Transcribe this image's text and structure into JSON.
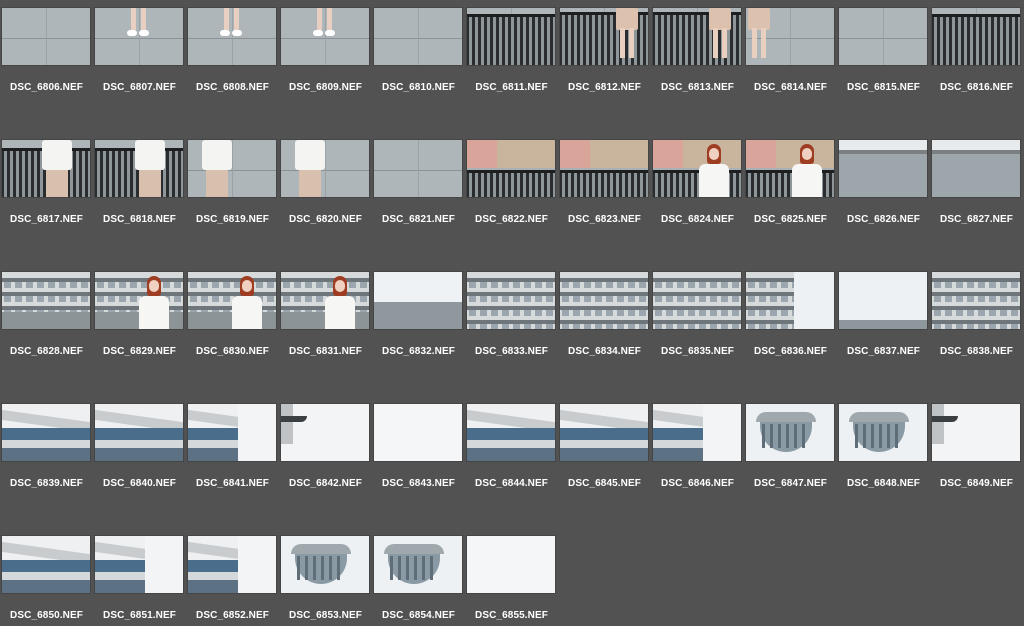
{
  "window": {
    "title": ""
  },
  "colors": {
    "background": "#525252",
    "label": "#ffffff"
  },
  "grid": {
    "columns": 11,
    "files": [
      {
        "name": "DSC_6806.NEF",
        "scene": "pavement"
      },
      {
        "name": "DSC_6807.NEF",
        "scene": "feet"
      },
      {
        "name": "DSC_6808.NEF",
        "scene": "feet"
      },
      {
        "name": "DSC_6809.NEF",
        "scene": "feet"
      },
      {
        "name": "DSC_6810.NEF",
        "scene": "pavement"
      },
      {
        "name": "DSC_6811.NEF",
        "scene": "railing"
      },
      {
        "name": "DSC_6812.NEF",
        "scene": "railing-legs"
      },
      {
        "name": "DSC_6813.NEF",
        "scene": "railing-legs"
      },
      {
        "name": "DSC_6814.NEF",
        "scene": "legs"
      },
      {
        "name": "DSC_6815.NEF",
        "scene": "pavement"
      },
      {
        "name": "DSC_6816.NEF",
        "scene": "railing"
      },
      {
        "name": "DSC_6817.NEF",
        "scene": "railing-torso"
      },
      {
        "name": "DSC_6818.NEF",
        "scene": "railing-torso"
      },
      {
        "name": "DSC_6819.NEF",
        "scene": "torso"
      },
      {
        "name": "DSC_6820.NEF",
        "scene": "torso"
      },
      {
        "name": "DSC_6821.NEF",
        "scene": "pavement"
      },
      {
        "name": "DSC_6822.NEF",
        "scene": "embankment"
      },
      {
        "name": "DSC_6823.NEF",
        "scene": "embankment"
      },
      {
        "name": "DSC_6824.NEF",
        "scene": "embankment-woman"
      },
      {
        "name": "DSC_6825.NEF",
        "scene": "embankment-woman"
      },
      {
        "name": "DSC_6826.NEF",
        "scene": "promenade"
      },
      {
        "name": "DSC_6827.NEF",
        "scene": "promenade"
      },
      {
        "name": "DSC_6828.NEF",
        "scene": "building"
      },
      {
        "name": "DSC_6829.NEF",
        "scene": "building-woman"
      },
      {
        "name": "DSC_6830.NEF",
        "scene": "building-woman"
      },
      {
        "name": "DSC_6831.NEF",
        "scene": "building-woman"
      },
      {
        "name": "DSC_6832.NEF",
        "scene": "promenade-sky"
      },
      {
        "name": "DSC_6833.NEF",
        "scene": "facade"
      },
      {
        "name": "DSC_6834.NEF",
        "scene": "facade"
      },
      {
        "name": "DSC_6835.NEF",
        "scene": "facade"
      },
      {
        "name": "DSC_6836.NEF",
        "scene": "facade-sky"
      },
      {
        "name": "DSC_6837.NEF",
        "scene": "sky-low"
      },
      {
        "name": "DSC_6838.NEF",
        "scene": "facade"
      },
      {
        "name": "DSC_6839.NEF",
        "scene": "balcony"
      },
      {
        "name": "DSC_6840.NEF",
        "scene": "balcony"
      },
      {
        "name": "DSC_6841.NEF",
        "scene": "balcony-sky"
      },
      {
        "name": "DSC_6842.NEF",
        "scene": "sky-edge"
      },
      {
        "name": "DSC_6843.NEF",
        "scene": "sky"
      },
      {
        "name": "DSC_6844.NEF",
        "scene": "balcony"
      },
      {
        "name": "DSC_6845.NEF",
        "scene": "balcony"
      },
      {
        "name": "DSC_6846.NEF",
        "scene": "balcony-sky"
      },
      {
        "name": "DSC_6847.NEF",
        "scene": "tower"
      },
      {
        "name": "DSC_6848.NEF",
        "scene": "tower"
      },
      {
        "name": "DSC_6849.NEF",
        "scene": "sky-edge"
      },
      {
        "name": "DSC_6850.NEF",
        "scene": "balcony"
      },
      {
        "name": "DSC_6851.NEF",
        "scene": "balcony-sky"
      },
      {
        "name": "DSC_6852.NEF",
        "scene": "balcony-sky"
      },
      {
        "name": "DSC_6853.NEF",
        "scene": "tower"
      },
      {
        "name": "DSC_6854.NEF",
        "scene": "tower"
      },
      {
        "name": "DSC_6855.NEF",
        "scene": "sky"
      }
    ]
  }
}
